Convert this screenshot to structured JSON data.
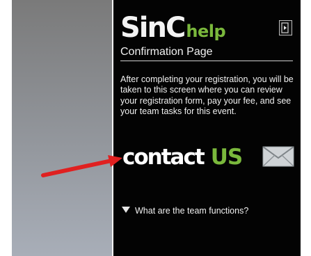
{
  "header": {
    "logo_main": "SinC",
    "logo_help": "help",
    "exit_icon": "exit-icon"
  },
  "page": {
    "subtitle": "Confirmation Page",
    "description": "After completing your registration, you will be taken to this screen where you can review your registration form, pay your fee, and see your team tasks for this event."
  },
  "contact": {
    "text": "contact",
    "us": "US",
    "mail_icon": "envelope-icon"
  },
  "faq": {
    "question": "What are the team functions?",
    "icon": "triangle-down-icon"
  },
  "colors": {
    "panel_bg": "#030303",
    "accent_green": "#7ab83c",
    "arrow_red": "#e02020"
  }
}
